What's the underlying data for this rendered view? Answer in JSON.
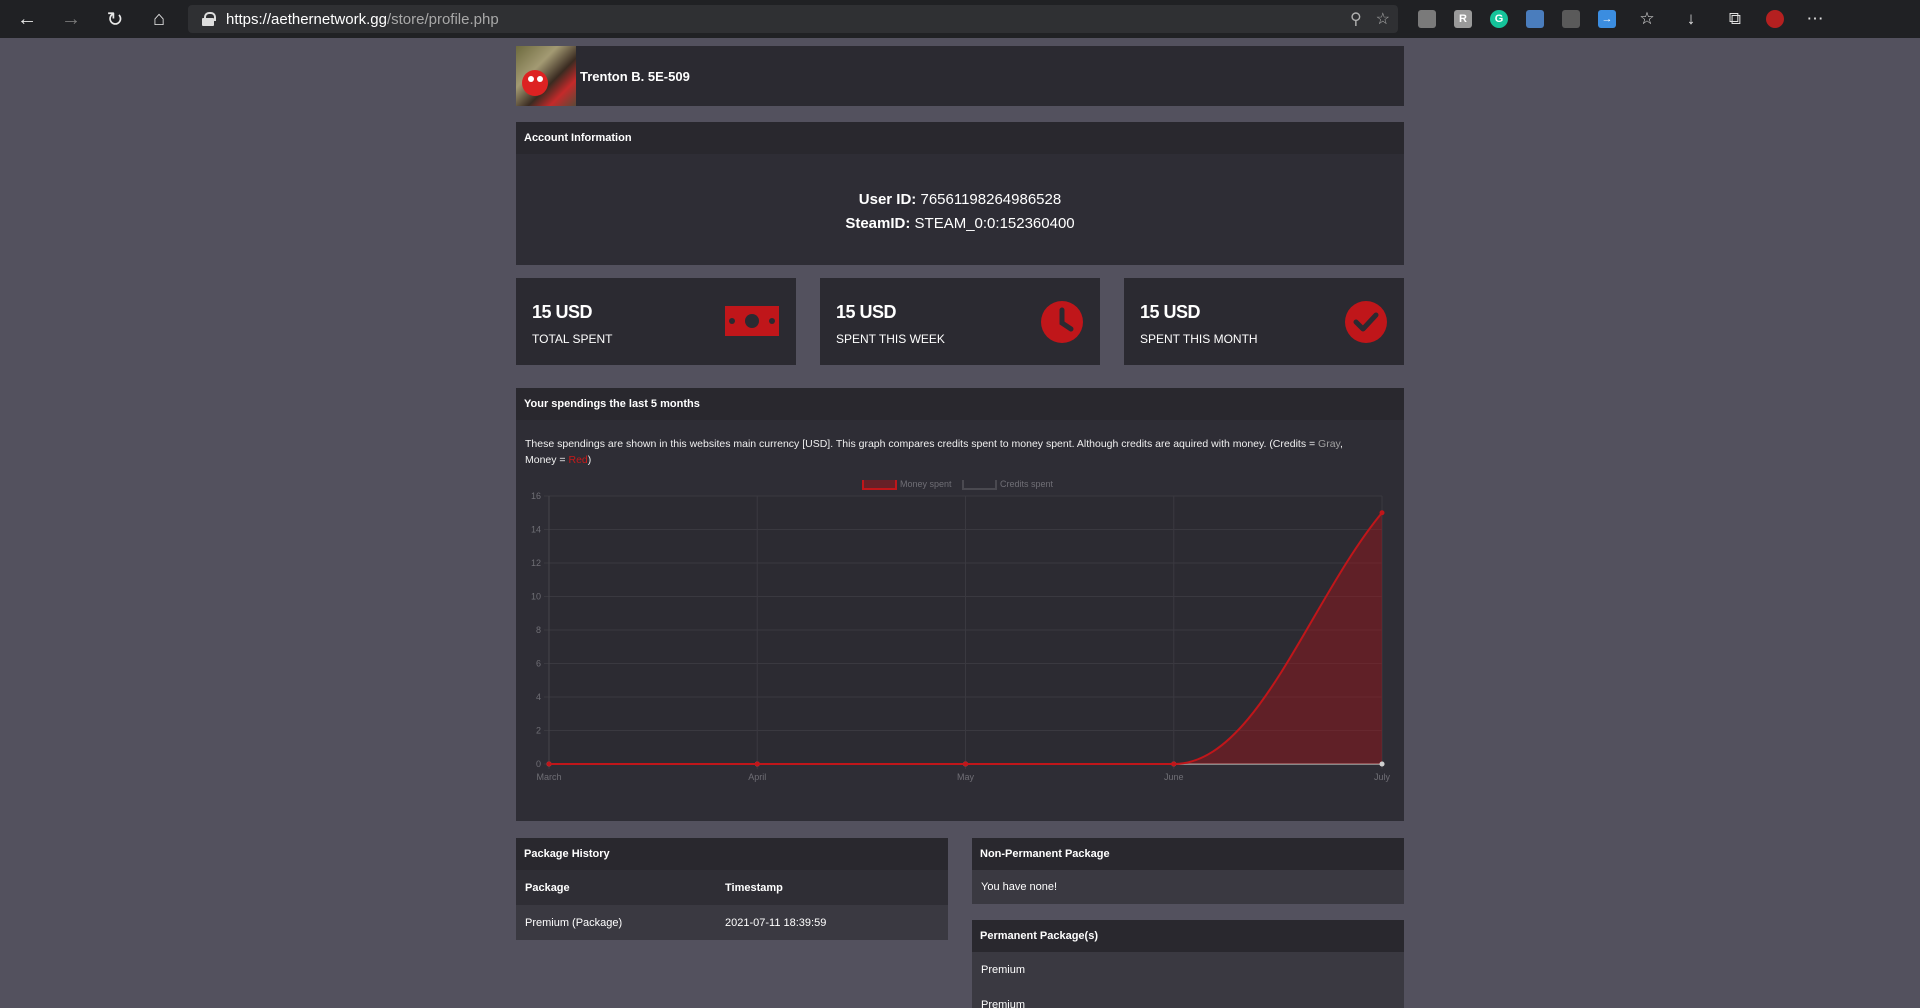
{
  "browser": {
    "url_host": "https://aethernetwork.gg",
    "url_path": "/store/profile.php",
    "extension_icons": [
      "collections-icon",
      "reader-icon",
      "grammarly-icon",
      "image-icon",
      "tab-icon",
      "key-icon"
    ],
    "toolbar_icons": [
      "favorites-icon",
      "downloads-icon",
      "collections-icon",
      "profile-icon",
      "more-icon"
    ]
  },
  "profile": {
    "name": "Trenton B. 5E-509"
  },
  "account": {
    "header": "Account Information",
    "user_id_label": "User ID:",
    "user_id": "76561198264986528",
    "steam_label": "SteamID:",
    "steam_id": "STEAM_0:0:152360400"
  },
  "stats": [
    {
      "value": "15 USD",
      "label": "TOTAL SPENT",
      "icon": "money-icon"
    },
    {
      "value": "15 USD",
      "label": "SPENT THIS WEEK",
      "icon": "clock-icon"
    },
    {
      "value": "15 USD",
      "label": "SPENT THIS MONTH",
      "icon": "check-icon"
    }
  ],
  "spendings": {
    "header": "Your spendings the last 5 months",
    "desc_a": "These spendings are shown in this websites main currency [USD]. This graph compares credits spent to money spent. Although credits are aquired with money. (Credits = ",
    "desc_gray": "Gray",
    "desc_b": ",",
    "desc_c": "Money = ",
    "desc_red": "Red",
    "desc_d": ")"
  },
  "chart_data": {
    "type": "line",
    "categories": [
      "March",
      "April",
      "May",
      "June",
      "July"
    ],
    "series": [
      {
        "name": "Money spent",
        "values": [
          0,
          0,
          0,
          0,
          15
        ],
        "color": "#c0161a"
      },
      {
        "name": "Credits spent",
        "values": [
          0,
          0,
          0,
          0,
          0
        ],
        "color": "#888888"
      }
    ],
    "y_ticks": [
      "0",
      "2",
      "4",
      "6",
      "8",
      "10",
      "12",
      "14",
      "16"
    ],
    "ylim": [
      0,
      16
    ],
    "grid": true,
    "legend_position": "top"
  },
  "package_history": {
    "header": "Package History",
    "columns": [
      "Package",
      "Timestamp"
    ],
    "rows": [
      [
        "Premium (Package)",
        "2021-07-11 18:39:59"
      ]
    ]
  },
  "non_permanent": {
    "header": "Non-Permanent Package",
    "text": "You have none!"
  },
  "permanent": {
    "header": "Permanent Package(s)",
    "items": [
      "Premium",
      "Premium"
    ]
  },
  "colors": {
    "accent": "#c0161a",
    "page_bg": "#53515e",
    "panel_bg": "#2e2d35"
  }
}
